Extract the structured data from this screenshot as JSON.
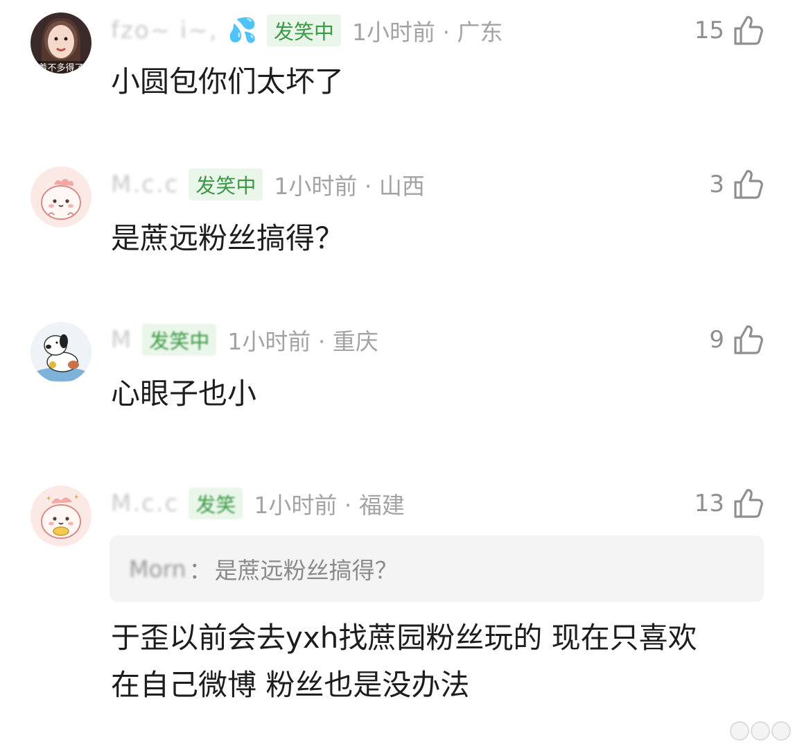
{
  "comments": [
    {
      "username": "fzo~ i~,",
      "emoji": "💦",
      "tag": "发笑中",
      "time_location": "1小时前 · 广东",
      "likes": "15",
      "text": "小圆包你们太坏了",
      "avatar_caption": "着不多得了"
    },
    {
      "username": "M.c.c",
      "tag": "发笑中",
      "time_location": "1小时前 · 山西",
      "likes": "3",
      "text": "是蔗远粉丝搞得？"
    },
    {
      "username": "M",
      "tag": "发笑中",
      "time_location": "1小时前 · 重庆",
      "likes": "9",
      "text": "心眼子也小"
    },
    {
      "username": "M.c.c",
      "tag": "发笑",
      "time_location": "1小时前 · 福建",
      "likes": "13",
      "quote_user": "Morn",
      "quote_separator": "：",
      "quote_text": "是蔗远粉丝搞得？",
      "text_line1": "于歪以前会去yxh找蔗园粉丝玩的 现在只喜欢",
      "text_line2": "在自己微博 粉丝也是没办法"
    }
  ],
  "colors": {
    "tag_bg": "#eaf6ea",
    "tag_text": "#3c9a46",
    "meta_text": "#a3a3a3",
    "body_text": "#1d1d1d",
    "quote_bg": "#f4f4f4"
  },
  "icons": {
    "like": "thumbs-up-icon"
  }
}
